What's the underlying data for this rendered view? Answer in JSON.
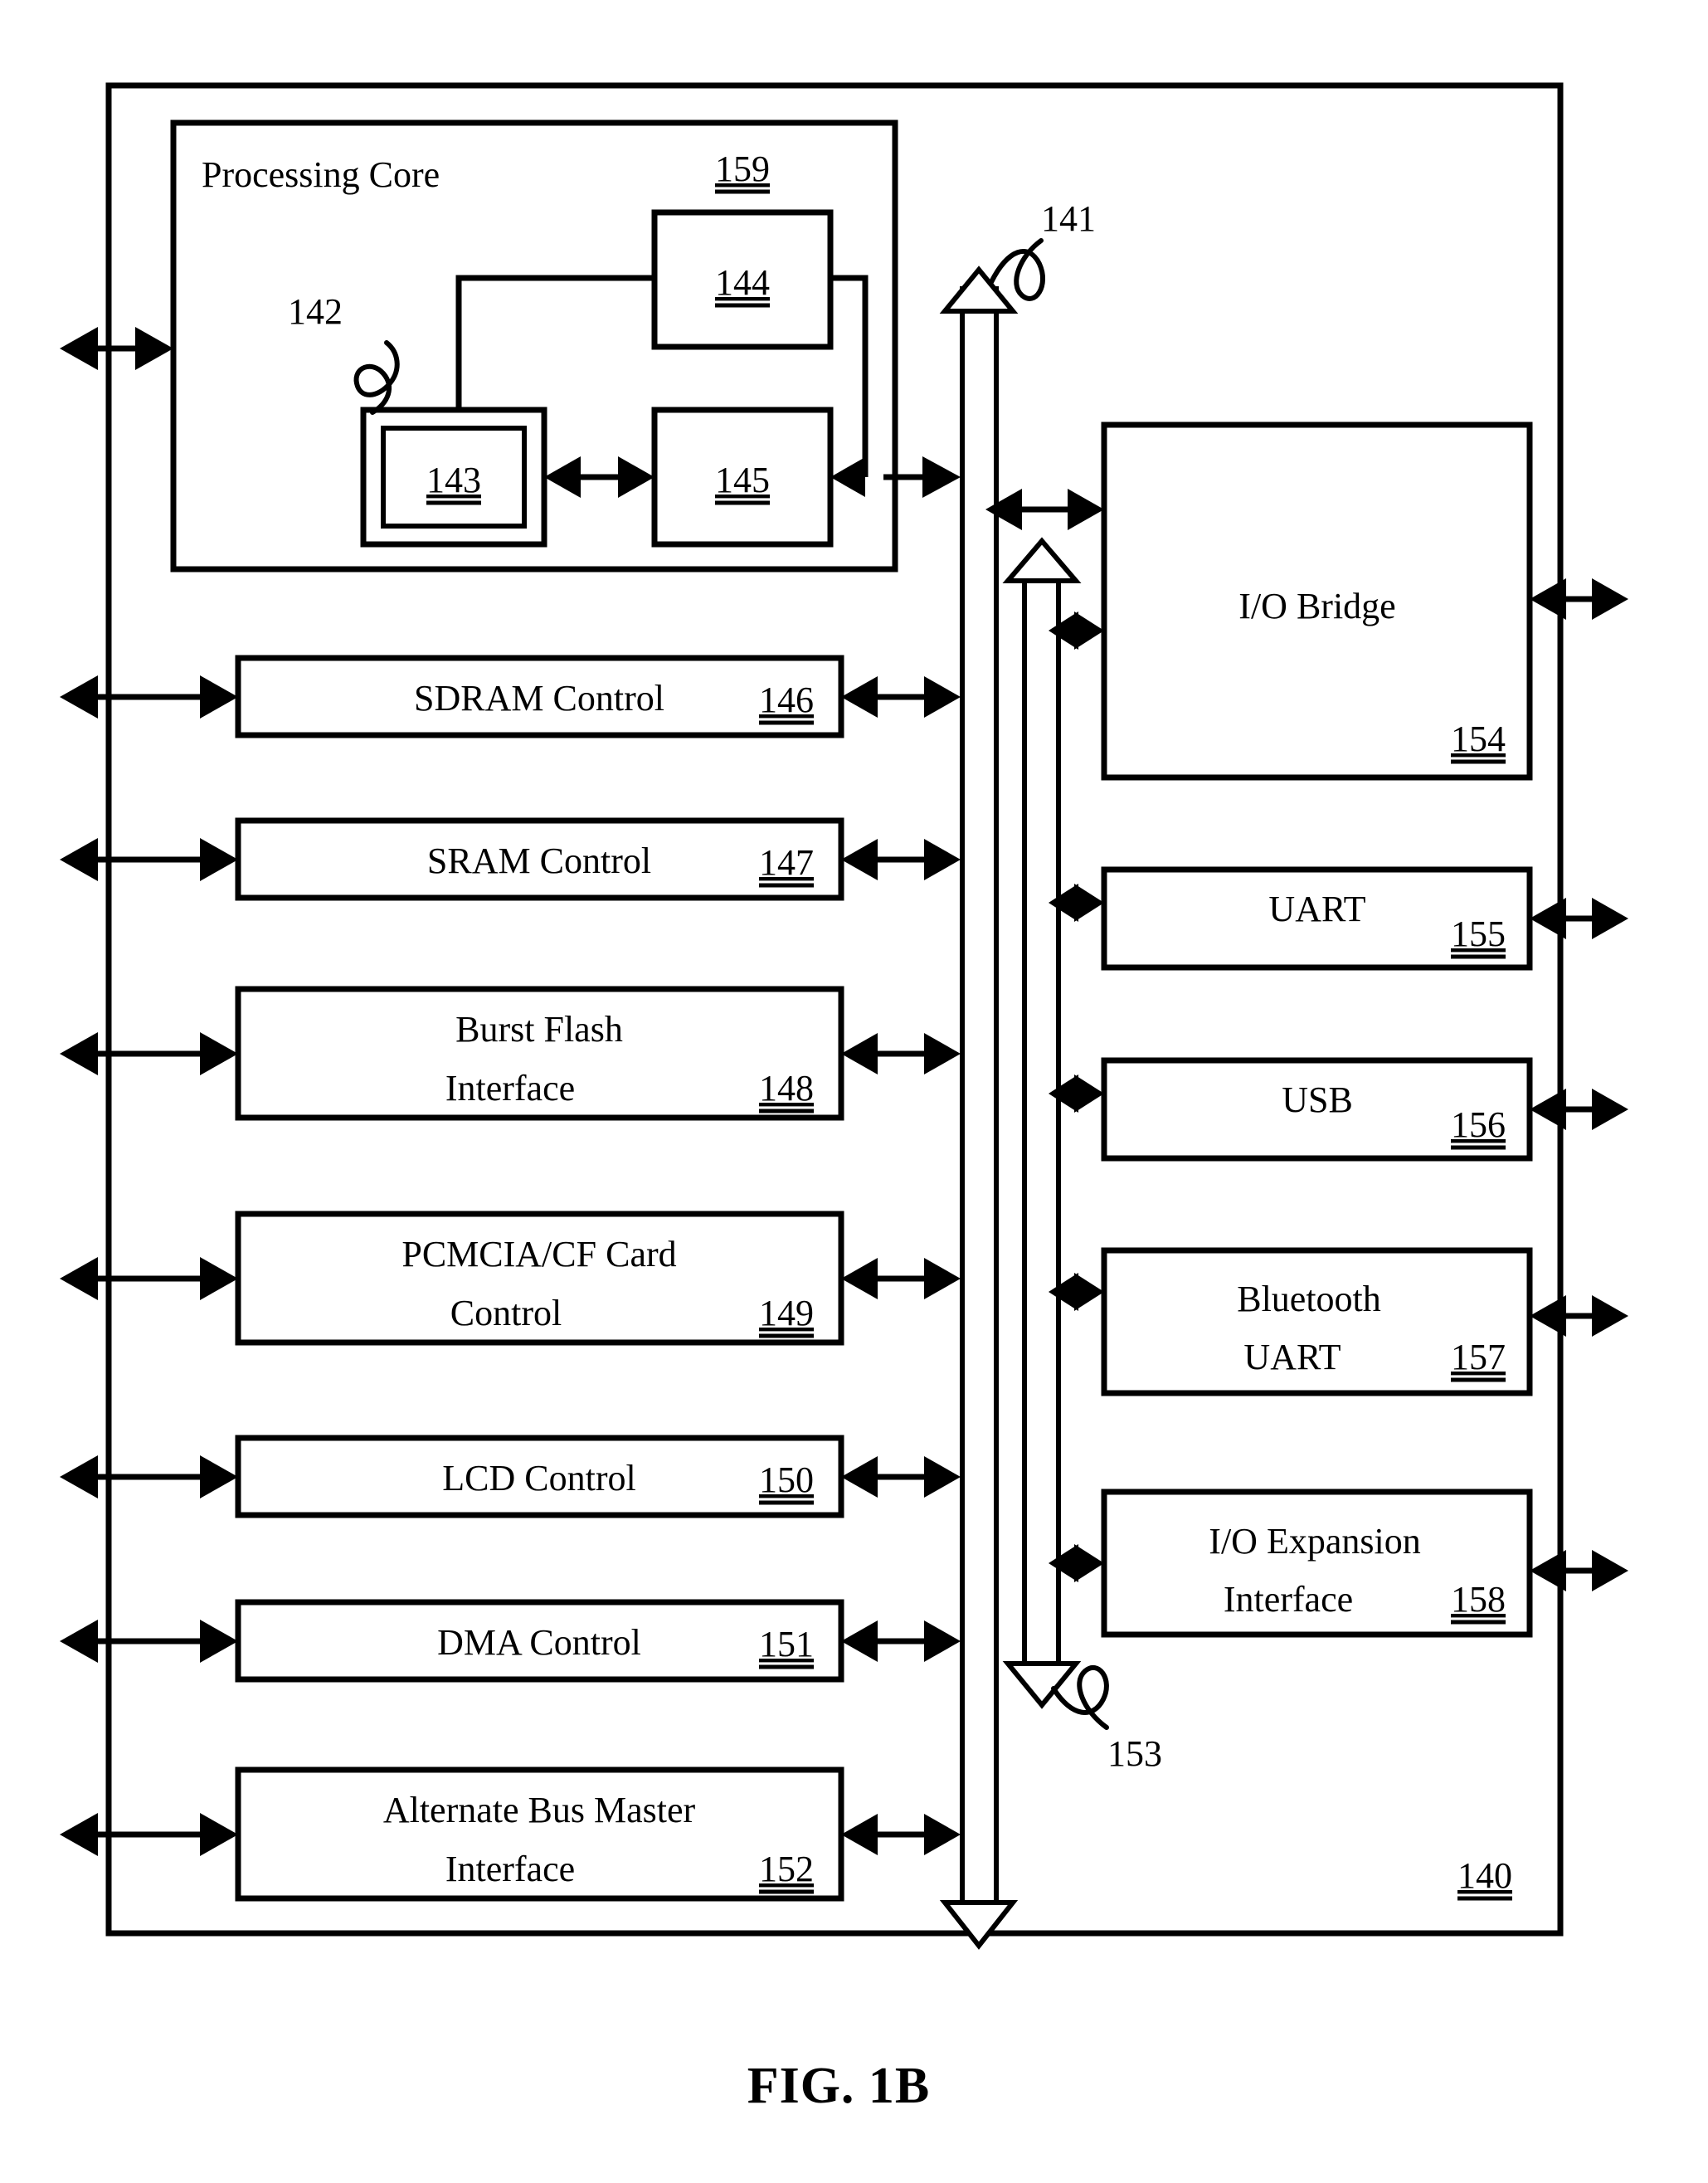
{
  "figure": {
    "caption": "FIG. 1B",
    "outer_ref": "140",
    "processing_core": {
      "title": "Processing Core",
      "ref": "159",
      "inner_ref": "142",
      "units": [
        {
          "ref": "144"
        },
        {
          "ref": "143"
        },
        {
          "ref": "145"
        }
      ]
    },
    "bus_labels": {
      "main_bus": "141",
      "io_bus": "153"
    },
    "left_blocks": [
      {
        "label_line1": "SDRAM Control",
        "label_line2": "",
        "ref": "146"
      },
      {
        "label_line1": "SRAM Control",
        "label_line2": "",
        "ref": "147"
      },
      {
        "label_line1": "Burst Flash",
        "label_line2": "Interface",
        "ref": "148"
      },
      {
        "label_line1": "PCMCIA/CF Card",
        "label_line2": "Control",
        "ref": "149"
      },
      {
        "label_line1": "LCD Control",
        "label_line2": "",
        "ref": "150"
      },
      {
        "label_line1": "DMA Control",
        "label_line2": "",
        "ref": "151"
      },
      {
        "label_line1": "Alternate Bus Master",
        "label_line2": "Interface",
        "ref": "152"
      }
    ],
    "right_blocks": [
      {
        "label_line1": "I/O Bridge",
        "label_line2": "",
        "ref": "154"
      },
      {
        "label_line1": "UART",
        "label_line2": "",
        "ref": "155"
      },
      {
        "label_line1": "USB",
        "label_line2": "",
        "ref": "156"
      },
      {
        "label_line1": "Bluetooth",
        "label_line2": "UART",
        "ref": "157"
      },
      {
        "label_line1": "I/O Expansion",
        "label_line2": "Interface",
        "ref": "158"
      }
    ]
  },
  "colors": {
    "ink": "#000000",
    "paper": "#ffffff"
  }
}
